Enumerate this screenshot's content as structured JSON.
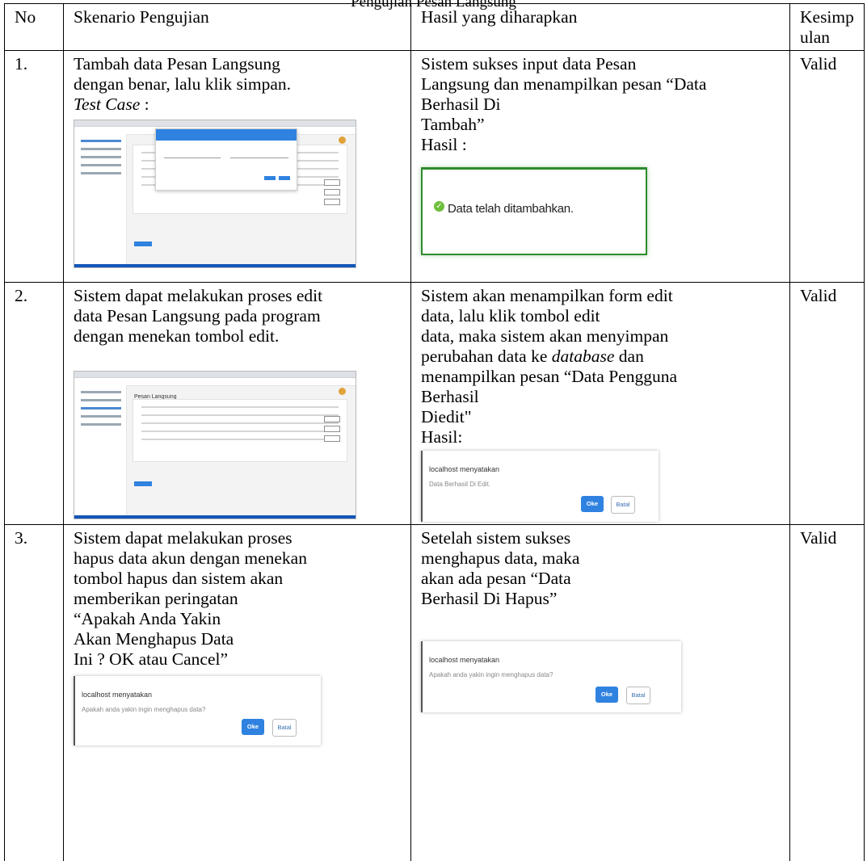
{
  "caption": "Pengujian Pesan Langsung",
  "table": {
    "headers": {
      "no": "No",
      "skenario": "Skenario Pengujian",
      "hasil": "Hasil yang diharapkan",
      "kesimpulan": [
        "Kesimp",
        "ulan"
      ]
    },
    "rows": [
      {
        "no": "1.",
        "skenario_lines": [
          "Tambah data Pesan Langsung",
          "dengan benar, lalu klik simpan."
        ],
        "test_case_label": "Test Case",
        "test_case_suffix": " :",
        "hasil_lines": [
          "Sistem sukses input data Pesan",
          "Langsung dan menampilkan pesan “Data",
          "Berhasil Di",
          "Tambah”",
          "Hasil :"
        ],
        "success_message": "Data telah ditambahkan.",
        "kesimpulan": "Valid"
      },
      {
        "no": "2.",
        "skenario_lines": [
          "Sistem dapat melakukan proses edit",
          "data Pesan Langsung pada program",
          "dengan menekan tombol edit."
        ],
        "thumb_title": "Pesan Langsung",
        "hasil_lines": [
          "Sistem akan menampilkan form edit",
          "data, lalu klik tombol edit",
          "data, maka sistem akan menyimpan"
        ],
        "hasil_pre_italic": "perubahan data ke ",
        "hasil_italic": "database",
        "hasil_post_italic": " dan",
        "hasil_lines_2": [
          "menampilkan pesan “Data Pengguna",
          "Berhasil",
          "Diedit\"",
          "Hasil:"
        ],
        "dialog": {
          "title": "localhost menyatakan",
          "message": "Data Berhasil Di Edit.",
          "ok": "Oke",
          "cancel": "Batal"
        },
        "kesimpulan": "Valid"
      },
      {
        "no": "3.",
        "skenario_lines": [
          "Sistem dapat melakukan proses",
          "hapus data akun dengan menekan",
          "tombol hapus dan sistem akan",
          "memberikan peringatan",
          "“Apakah Anda Yakin",
          "Akan Menghapus Data",
          "Ini ? OK atau Cancel”"
        ],
        "dialog_left": {
          "title": "localhost menyatakan",
          "message": "Apakah anda yakin ingin menghapus data?",
          "ok": "Oke",
          "cancel": "Batal"
        },
        "hasil_lines": [
          "Setelah sistem sukses",
          "menghapus data, maka",
          "akan ada pesan “Data",
          "Berhasil Di Hapus”"
        ],
        "dialog_right": {
          "title": "localhost menyatakan",
          "message": "Apakah anda yakin ingin menghapus data?",
          "ok": "Oke",
          "cancel": "Batal"
        },
        "kesimpulan": "Valid"
      }
    ]
  }
}
